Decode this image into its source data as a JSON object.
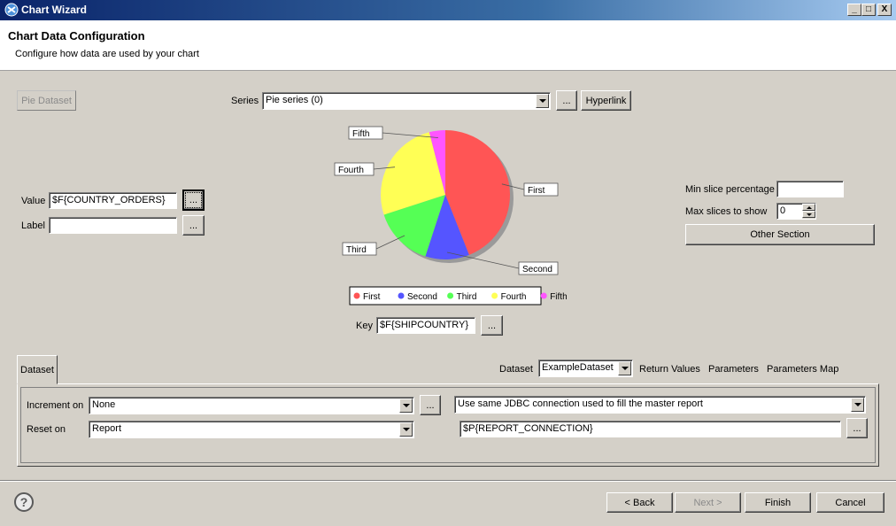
{
  "window": {
    "title": "Chart Wizard",
    "minimize": "_",
    "maximize": "□",
    "close": "X"
  },
  "header": {
    "title": "Chart Data Configuration",
    "description": "Configure how data are used by your chart"
  },
  "pie_dataset_button": "Pie Dataset",
  "series": {
    "label": "Series",
    "value": "Pie series (0)",
    "more_button": "...",
    "hyperlink_button": "Hyperlink"
  },
  "value_field": {
    "label": "Value",
    "value": "$F{COUNTRY_ORDERS}",
    "more_button": "..."
  },
  "label_field": {
    "label": "Label",
    "value": "",
    "more_button": "..."
  },
  "key_field": {
    "label": "Key",
    "value": "$F{SHIPCOUNTRY}",
    "more_button": "..."
  },
  "right_options": {
    "min_slice_label": "Min slice percentage",
    "min_slice_value": "",
    "max_slices_label": "Max slices to show",
    "max_slices_value": "0",
    "other_section_button": "Other Section"
  },
  "chart_data": {
    "type": "pie",
    "slices": [
      {
        "name": "First",
        "value": 44,
        "color": "#ff5555"
      },
      {
        "name": "Second",
        "value": 11,
        "color": "#5555ff"
      },
      {
        "name": "Third",
        "value": 15,
        "color": "#55ff55"
      },
      {
        "name": "Fourth",
        "value": 26,
        "color": "#ffff55"
      },
      {
        "name": "Fifth",
        "value": 4,
        "color": "#ff55ff"
      }
    ],
    "legend": "bottom"
  },
  "dataset_tab": {
    "tab_label": "Dataset",
    "dataset_label": "Dataset",
    "dataset_value": "ExampleDataset",
    "return_values": "Return Values",
    "parameters": "Parameters",
    "parameters_map": "Parameters Map",
    "increment_on_label": "Increment on",
    "increment_on_value": "None",
    "increment_more_button": "...",
    "reset_on_label": "Reset on",
    "reset_on_value": "Report",
    "connection_value": "Use same JDBC connection used to fill the master report",
    "connection_expression": "$P{REPORT_CONNECTION}",
    "connection_more_button": "..."
  },
  "footer": {
    "help": "?",
    "back": "< Back",
    "next": "Next >",
    "finish": "Finish",
    "cancel": "Cancel"
  }
}
